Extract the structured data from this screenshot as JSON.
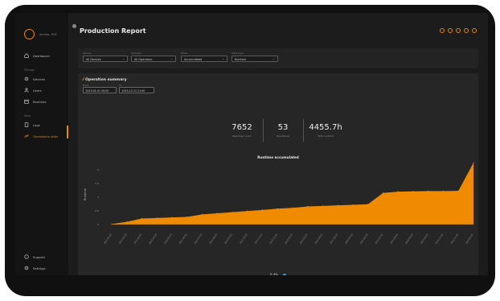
{
  "app": {
    "brand": "Access, XYZ",
    "page_title": "Production Report"
  },
  "sidebar": {
    "items_main": [
      {
        "label": "Dashboard",
        "icon": "home-icon"
      }
    ],
    "sections": [
      {
        "title": "Manage",
        "items": [
          {
            "label": "Devices",
            "icon": "gear-icon"
          },
          {
            "label": "Users",
            "icon": "users-icon"
          },
          {
            "label": "Routines",
            "icon": "calendar-icon"
          }
        ]
      },
      {
        "title": "Data",
        "items": [
          {
            "label": "Logs",
            "icon": "log-icon"
          },
          {
            "label": "Operations stats",
            "icon": "chart-icon",
            "active": true
          }
        ]
      }
    ],
    "bottom_items": [
      {
        "label": "Support",
        "icon": "help-icon"
      },
      {
        "label": "Settings",
        "icon": "settings-icon"
      }
    ]
  },
  "filters": [
    {
      "label": "Device",
      "value": "All Devices"
    },
    {
      "label": "Operator",
      "value": "All Operators"
    },
    {
      "label": "Mode",
      "value": "Accumulated"
    },
    {
      "label": "Data type",
      "value": "Runtime"
    }
  ],
  "summary": {
    "title": "Operation summary",
    "from_label": "From",
    "from_value": "2023-01-01 00:00",
    "to_label": "To",
    "to_value": "2025-12-11 21:00",
    "stats": [
      {
        "value": "7652",
        "label": "Readings count"
      },
      {
        "value": "53",
        "label": "Operations"
      },
      {
        "value": "4455.7h",
        "label": "Total runtime"
      }
    ]
  },
  "chart_data": {
    "type": "area",
    "title": "Runtime accumulated",
    "ylabel": "Runtime",
    "xlabel": "",
    "yticks": [
      "0",
      "0.5",
      "1",
      "1.5",
      "2"
    ],
    "ylim": [
      0,
      2.2
    ],
    "x": [
      "2021-01-01",
      "2021-02-01",
      "2021-03-01",
      "2021-04-01",
      "2021-05-01",
      "2021-06-01",
      "2021-07-01",
      "2021-08-01",
      "2021-09-01",
      "2021-10-01",
      "2021-11-01",
      "2021-12-01",
      "2022-01-01",
      "2022-02-01",
      "2022-03-01",
      "2022-04-01",
      "2022-05-01",
      "2022-06-01",
      "2022-07-01",
      "2022-08-01",
      "2022-09-01",
      "2022-10-01",
      "2022-11-01",
      "2022-12-01",
      "2023-01-01"
    ],
    "values": [
      0.02,
      0.1,
      0.22,
      0.24,
      0.26,
      0.28,
      0.37,
      0.41,
      0.45,
      0.49,
      0.53,
      0.58,
      0.61,
      0.66,
      0.68,
      0.7,
      0.72,
      0.74,
      1.15,
      1.2,
      1.21,
      1.22,
      1.22,
      1.23,
      2.25
    ],
    "series": [
      {
        "name": "",
        "color": "#f08a00",
        "values": [
          0.02,
          0.1,
          0.22,
          0.24,
          0.26,
          0.28,
          0.37,
          0.41,
          0.45,
          0.49,
          0.53,
          0.58,
          0.61,
          0.66,
          0.68,
          0.7,
          0.72,
          0.74,
          1.15,
          1.2,
          1.21,
          1.22,
          1.22,
          1.23,
          2.25
        ]
      }
    ],
    "legend": {
      "label": "0.4%",
      "color": "#2e9fe0",
      "placement": "bottom-center"
    },
    "grid": false
  },
  "colors": {
    "accent": "#e8860c",
    "area": "#f08a00",
    "legend_dot": "#2e9fe0"
  }
}
